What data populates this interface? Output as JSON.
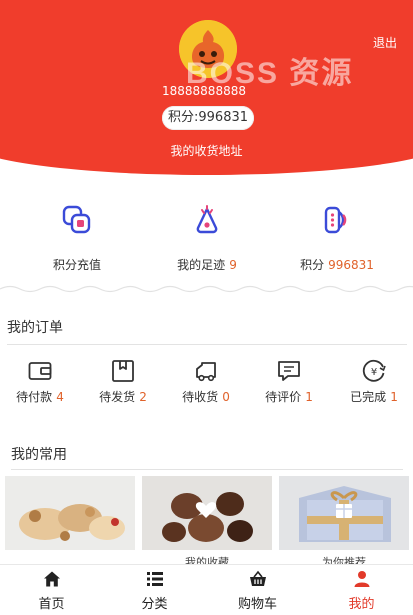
{
  "header": {
    "logout_label": "退出",
    "watermark": "BOSS 资源",
    "phone": "18888888888",
    "points_text": "积分:996831",
    "address_label": "我的收货地址"
  },
  "quick_actions": [
    {
      "label": "积分充值",
      "count": "",
      "icon": "recharge-icon"
    },
    {
      "label": "我的足迹",
      "count": "9",
      "icon": "footprint-icon"
    },
    {
      "label": "积分",
      "count": "996831",
      "icon": "points-icon"
    }
  ],
  "orders": {
    "title": "我的订单",
    "items": [
      {
        "label": "待付款",
        "count": "4",
        "icon": "wallet-icon"
      },
      {
        "label": "待发货",
        "count": "2",
        "icon": "box-icon"
      },
      {
        "label": "待收货",
        "count": "0",
        "icon": "truck-icon"
      },
      {
        "label": "待评价",
        "count": "1",
        "icon": "comment-icon"
      },
      {
        "label": "已完成",
        "count": "1",
        "icon": "yen-check-icon"
      }
    ]
  },
  "common": {
    "title": "我的常用",
    "cards": [
      {
        "label": "",
        "image": "cookies-image"
      },
      {
        "label": "我的收藏",
        "image": "chocolates-image"
      },
      {
        "label": "为你推荐",
        "image": "gift-box-image"
      }
    ]
  },
  "tabbar": [
    {
      "label": "首页",
      "icon": "home-icon",
      "active": false
    },
    {
      "label": "分类",
      "icon": "list-icon",
      "active": false
    },
    {
      "label": "购物车",
      "icon": "cart-icon",
      "active": false
    },
    {
      "label": "我的",
      "icon": "user-icon",
      "active": true
    }
  ],
  "colors": {
    "brand": "#f03d2c",
    "accent_number": "#e0622b",
    "icon_blue": "#3b4bd8",
    "icon_pink": "#e6457a"
  }
}
